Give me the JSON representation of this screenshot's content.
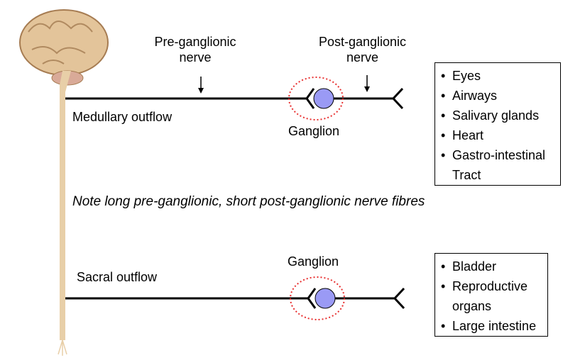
{
  "labels": {
    "pre_ganglionic": [
      "Pre-ganglionic",
      "nerve"
    ],
    "post_ganglionic": [
      "Post-ganglionic",
      "nerve"
    ],
    "medullary_outflow": "Medullary outflow",
    "ganglion_top": "Ganglion",
    "ganglion_bottom": "Ganglion",
    "sacral_outflow": "Sacral outflow",
    "note": "Note long pre-ganglionic, short post-ganglionic nerve fibres"
  },
  "medullary_targets": [
    "Eyes",
    "Airways",
    "Salivary glands",
    "Heart",
    "Gastro-intestinal",
    "Tract"
  ],
  "sacral_targets": [
    "Bladder",
    "Reproductive",
    "organs",
    "Large intestine"
  ],
  "colors": {
    "ganglion_fill": "#9a9af5",
    "ellipse": "#e83030",
    "cord": "#e8cfa8"
  }
}
